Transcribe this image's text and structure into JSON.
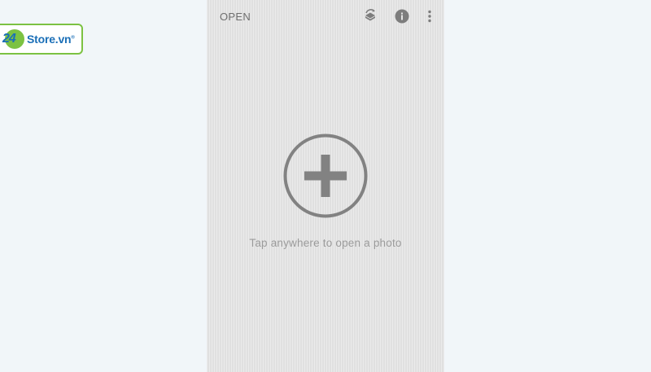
{
  "watermark": {
    "number": "24",
    "text": "Store.vn",
    "reg": "®",
    "colors": {
      "green": "#7cc242",
      "blue": "#1b6fb7"
    }
  },
  "toolbar": {
    "open_label": "OPEN",
    "icons": [
      "looks-stack-icon",
      "info-icon",
      "more-vert-icon"
    ]
  },
  "main": {
    "hint": "Tap anywhere to open a photo",
    "add_icon": "plus-circle-icon"
  },
  "colors": {
    "page_bg": "#f1f6f9",
    "screen_bg": "#e4e4e4",
    "icon_gray": "#7d7d7d",
    "text_gray": "#9b9b9b"
  }
}
